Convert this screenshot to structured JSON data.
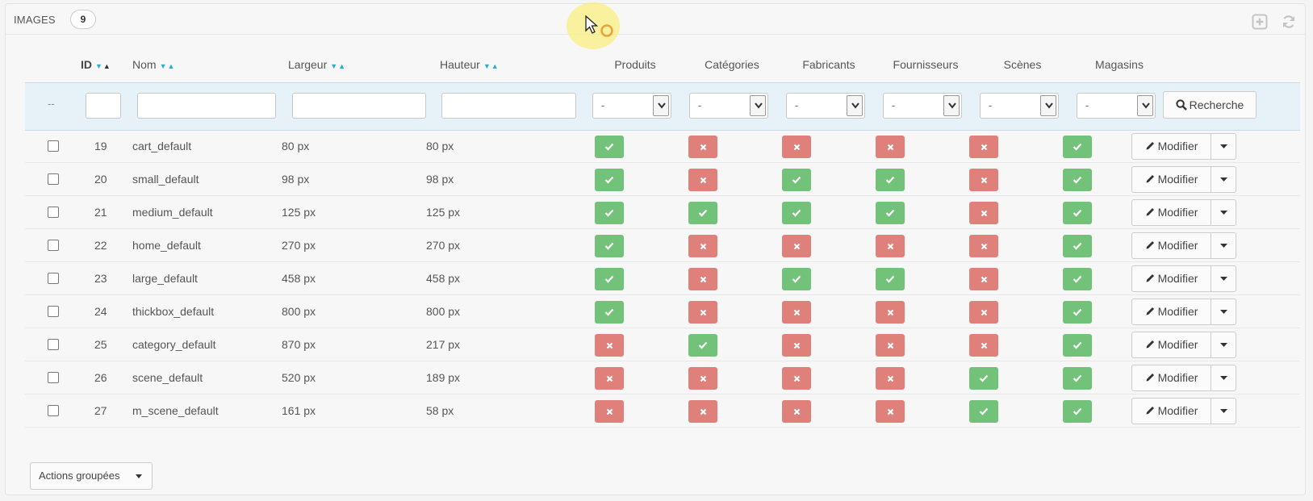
{
  "panel": {
    "title": "Images",
    "count": "9"
  },
  "columns": {
    "id": "ID",
    "name": "Nom",
    "width": "Largeur",
    "height": "Hauteur",
    "products": "Produits",
    "categories": "Catégories",
    "manufacturers": "Fabricants",
    "suppliers": "Fournisseurs",
    "scenes": "Scènes",
    "stores": "Magasins"
  },
  "filters": {
    "dash": "--",
    "select_value": "-",
    "search_label": "Recherche"
  },
  "rows": [
    {
      "id": "19",
      "name": "cart_default",
      "width": "80 px",
      "height": "80 px",
      "flags": [
        true,
        false,
        false,
        false,
        false,
        true
      ]
    },
    {
      "id": "20",
      "name": "small_default",
      "width": "98 px",
      "height": "98 px",
      "flags": [
        true,
        false,
        true,
        true,
        false,
        true
      ]
    },
    {
      "id": "21",
      "name": "medium_default",
      "width": "125 px",
      "height": "125 px",
      "flags": [
        true,
        true,
        true,
        true,
        false,
        true
      ]
    },
    {
      "id": "22",
      "name": "home_default",
      "width": "270 px",
      "height": "270 px",
      "flags": [
        true,
        false,
        false,
        false,
        false,
        true
      ]
    },
    {
      "id": "23",
      "name": "large_default",
      "width": "458 px",
      "height": "458 px",
      "flags": [
        true,
        false,
        true,
        true,
        false,
        true
      ]
    },
    {
      "id": "24",
      "name": "thickbox_default",
      "width": "800 px",
      "height": "800 px",
      "flags": [
        true,
        false,
        false,
        false,
        false,
        true
      ]
    },
    {
      "id": "25",
      "name": "category_default",
      "width": "870 px",
      "height": "217 px",
      "flags": [
        false,
        true,
        false,
        false,
        false,
        true
      ]
    },
    {
      "id": "26",
      "name": "scene_default",
      "width": "520 px",
      "height": "189 px",
      "flags": [
        false,
        false,
        false,
        false,
        true,
        true
      ]
    },
    {
      "id": "27",
      "name": "m_scene_default",
      "width": "161 px",
      "height": "58 px",
      "flags": [
        false,
        false,
        false,
        false,
        true,
        true
      ]
    }
  ],
  "row_action": {
    "edit_label": "Modifier"
  },
  "bulk": {
    "label": "Actions groupées"
  },
  "colors": {
    "ok": "#72c279",
    "no": "#e0807a",
    "filter_bg": "#e7f1f8",
    "sort_accent": "#2eacce"
  },
  "icons": {
    "ok": "check-icon",
    "no": "cross-icon",
    "search": "search-icon",
    "edit": "pencil-icon",
    "add": "plus-square-icon",
    "refresh": "refresh-icon"
  }
}
